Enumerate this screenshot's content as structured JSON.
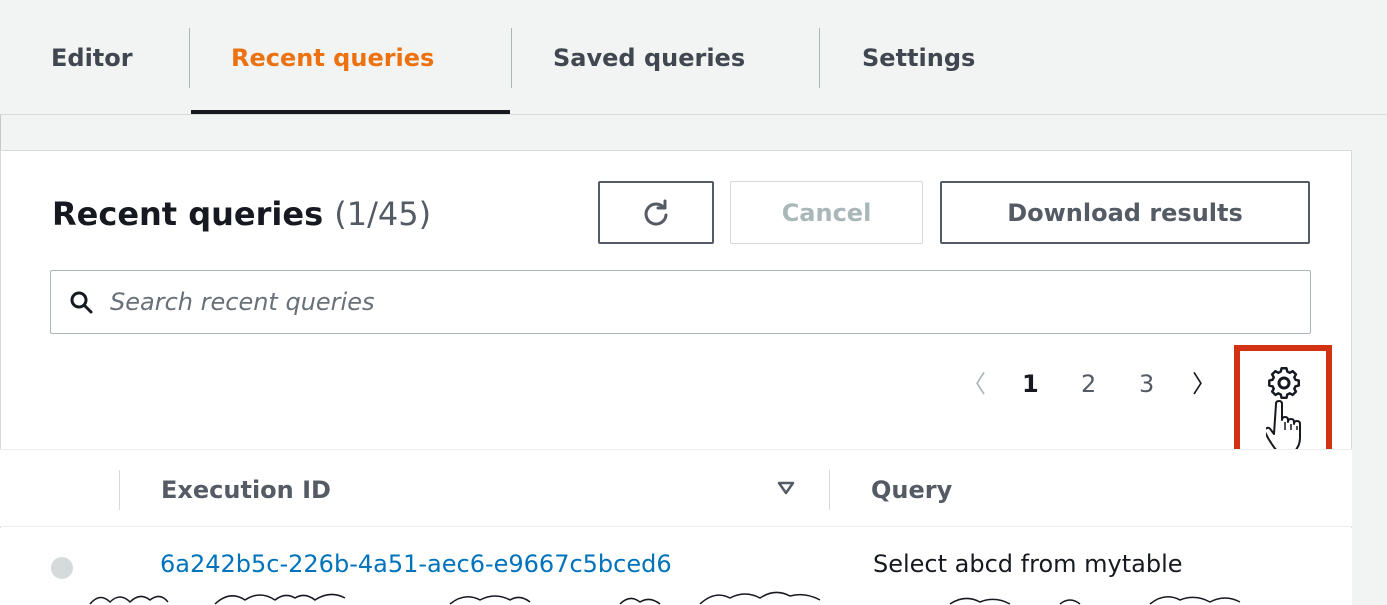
{
  "tabs": [
    {
      "label": "Editor"
    },
    {
      "label": "Recent queries"
    },
    {
      "label": "Saved queries"
    },
    {
      "label": "Settings"
    }
  ],
  "active_tab": "Recent queries",
  "header": {
    "title": "Recent queries",
    "counter": "(1/45)"
  },
  "toolbar": {
    "refresh_icon": "refresh-icon",
    "cancel_label": "Cancel",
    "download_label": "Download results"
  },
  "search": {
    "placeholder": "Search recent queries",
    "value": ""
  },
  "pagination": {
    "prev": "〈",
    "pages": [
      "1",
      "2",
      "3"
    ],
    "current": "1",
    "next": "〉"
  },
  "settings_icon": "gear-icon",
  "colors": {
    "accent": "#ec7211",
    "link": "#0073bb",
    "highlight": "#d13212"
  },
  "table": {
    "columns": [
      "Execution ID",
      "Query"
    ],
    "rows": [
      {
        "execution_id": "6a242b5c-226b-4a51-aec6-e9667c5bced6",
        "query": "Select abcd from mytable"
      }
    ]
  }
}
